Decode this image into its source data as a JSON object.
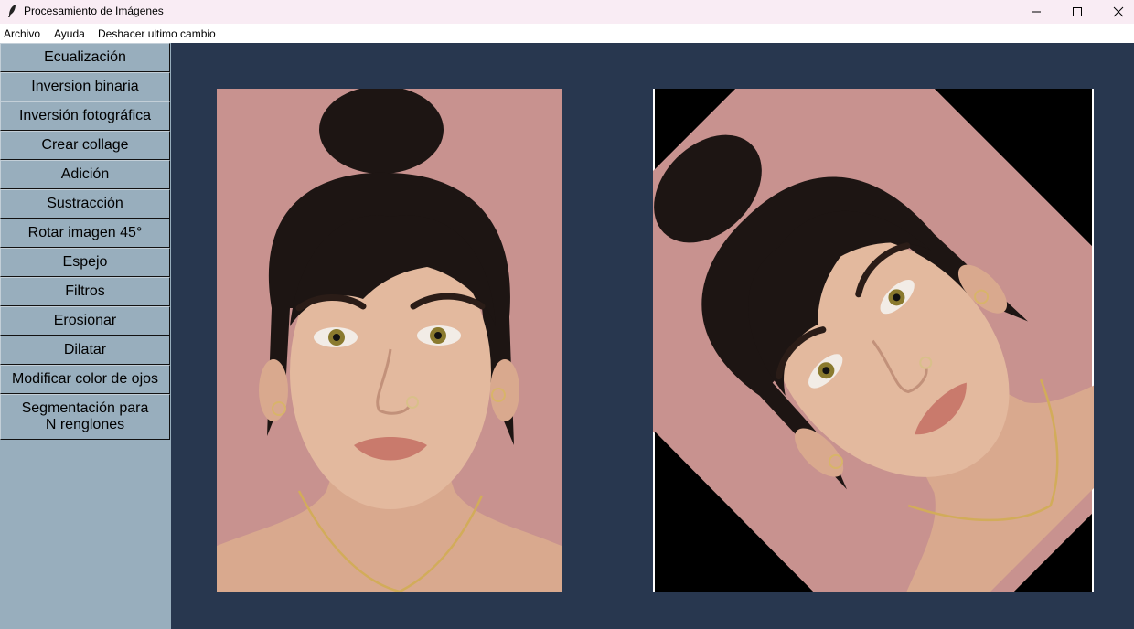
{
  "window": {
    "title": "Procesamiento de Imágenes"
  },
  "menu": [
    {
      "label": "Archivo"
    },
    {
      "label": "Ayuda"
    },
    {
      "label": "Deshacer ultimo cambio"
    }
  ],
  "sidebar": {
    "buttons": [
      {
        "label": "Ecualización"
      },
      {
        "label": "Inversion binaria"
      },
      {
        "label": "Inversión fotográfica"
      },
      {
        "label": "Crear collage"
      },
      {
        "label": "Adición"
      },
      {
        "label": "Sustracción"
      },
      {
        "label": "Rotar imagen 45°"
      },
      {
        "label": "Espejo"
      },
      {
        "label": "Filtros"
      },
      {
        "label": "Erosionar"
      },
      {
        "label": "Dilatar"
      },
      {
        "label": "Modificar color de ojos"
      },
      {
        "label": "Segmentación para\nN renglones"
      }
    ]
  },
  "colors": {
    "canvas": "#28374f",
    "sidebar": "#98aebd",
    "photo_background": "#c8928f",
    "hair": "#1d1513",
    "skin": "#e3b99e"
  },
  "images": {
    "original": "portrait-photo",
    "processed": "rotated-45-portrait-photo"
  }
}
